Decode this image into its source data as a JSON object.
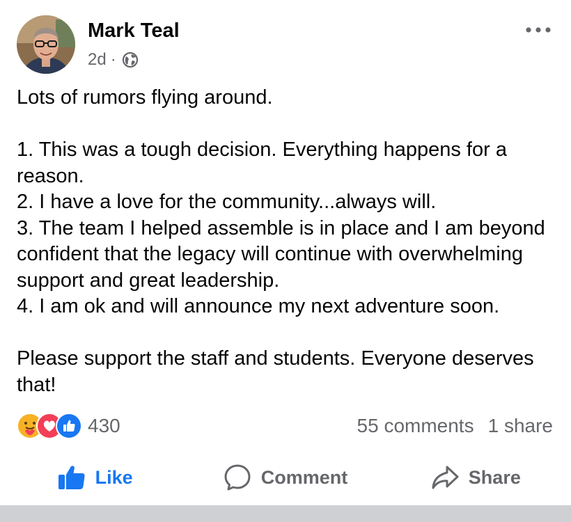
{
  "post": {
    "author": "Mark Teal",
    "time": "2d",
    "dot": "·",
    "privacy_icon": "globe-icon",
    "more_icon": "more-options-icon",
    "body": [
      "Lots of rumors flying around.",
      "",
      "1. This was a tough decision. Everything happens for a reason.",
      "2. I have a love for the community...always will.",
      "3. The team I helped assemble is in place and I am beyond confident that the legacy will continue with overwhelming support and great leadership.",
      "4. I am ok and will announce my next adventure soon.",
      "",
      "Please support the staff and students. Everyone deserves that!"
    ]
  },
  "reactions": {
    "icons": [
      "care-reaction-icon",
      "love-reaction-icon",
      "like-reaction-icon"
    ],
    "count": "430"
  },
  "stats": {
    "comments": "55 comments",
    "shares": "1 share"
  },
  "actions": {
    "like": "Like",
    "comment": "Comment",
    "share": "Share"
  },
  "colors": {
    "like_blue": "#1877f2",
    "love_red": "#f33e58",
    "care_yellow": "#f7b125",
    "secondary_text": "#65676b",
    "divider": "#ced0d4"
  }
}
